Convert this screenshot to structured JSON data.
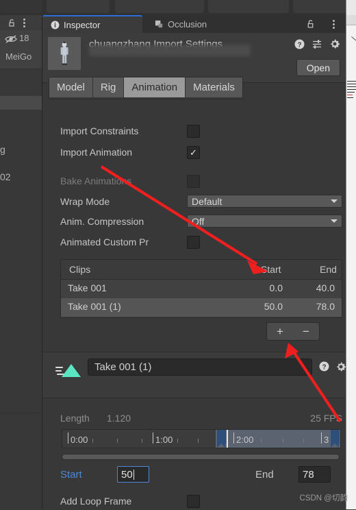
{
  "window": {
    "app": "Unity Editor",
    "background_tabs": [
      "",
      "",
      "",
      ""
    ]
  },
  "left_panel": {
    "lock_icon": "unlock-icon",
    "menu_icon": "kebab-menu-icon",
    "eye_icon": "eye-off-icon",
    "eye_count": "18",
    "name_partial": "MeiGo",
    "fragment_g": "g",
    "fragment_02": "02"
  },
  "inspector": {
    "tabs": [
      {
        "label": "Inspector",
        "icon": "info-icon",
        "active": true
      },
      {
        "label": "Occlusion",
        "icon": "occlusion-icon",
        "active": false
      }
    ],
    "lock_icon": "unlock-icon",
    "menu_icon": "kebab-menu-icon",
    "header": {
      "title": "chuangzhang Import Settings",
      "thumbnail": "character-preview-thumbnail",
      "help_icon": "help-icon",
      "preset_icon": "preset-sliders-icon",
      "gear_icon": "gear-icon",
      "open_label": "Open"
    },
    "model_tabs": [
      {
        "label": "Model",
        "selected": false
      },
      {
        "label": "Rig",
        "selected": false
      },
      {
        "label": "Animation",
        "selected": true
      },
      {
        "label": "Materials",
        "selected": false
      }
    ],
    "properties": [
      {
        "label": "Import Constraints",
        "type": "checkbox",
        "checked": false,
        "disabled": false
      },
      {
        "label": "Import Animation",
        "type": "checkbox",
        "checked": true,
        "disabled": false
      },
      {
        "label": "Bake Animations",
        "type": "checkbox",
        "checked": false,
        "disabled": true
      },
      {
        "label": "Wrap Mode",
        "type": "dropdown",
        "value": "Default",
        "disabled": false
      },
      {
        "label": "Anim. Compression",
        "type": "dropdown",
        "value": "Off",
        "disabled": false
      },
      {
        "label": "Animated Custom Pr",
        "type": "checkbox",
        "checked": false,
        "disabled": false
      }
    ],
    "clips": {
      "headers": {
        "name": "Clips",
        "start": "Start",
        "end": "End"
      },
      "rows": [
        {
          "name": "Take 001",
          "start": "0.0",
          "end": "40.0",
          "selected": false
        },
        {
          "name": "Take 001 (1)",
          "start": "50.0",
          "end": "78.0",
          "selected": true
        }
      ],
      "add_label": "+",
      "remove_label": "−"
    },
    "clip_editor": {
      "clip_icon": "animation-clip-icon",
      "clip_name": "Take 001 (1)",
      "help_icon": "help-icon",
      "gear_icon": "gear-icon"
    },
    "timeline": {
      "length_label": "Length",
      "length_value": "1.120",
      "fps_value": "25 FPS",
      "ticks": [
        {
          "label": "0:00",
          "major": true
        },
        {
          "label": "1:00",
          "major": true
        },
        {
          "label": "2:00",
          "major": true
        },
        {
          "label": "3",
          "major": true
        }
      ],
      "scrollbar": "horizontal-scrollbar"
    },
    "range": {
      "start_label": "Start",
      "start_value": "50",
      "end_label": "End",
      "end_value": "78"
    },
    "loop": {
      "label": "Add Loop Frame",
      "checked": false
    }
  },
  "annotations": {
    "arrow_color": "#f01f1f",
    "arrow_1_target": "clips-start-column",
    "arrow_2_target": "add-clip-button"
  },
  "watermark": {
    "text": "CSDN @切韵"
  },
  "colors": {
    "panel_bg": "#383838",
    "header_bg": "#3c3c3c",
    "tabbar_bg": "#303030",
    "accent_blue": "#2c6fd8",
    "field_blue": "#4f87d8",
    "clip_icon_teal": "#5ae6c0",
    "arrow_red": "#f01f1f"
  }
}
